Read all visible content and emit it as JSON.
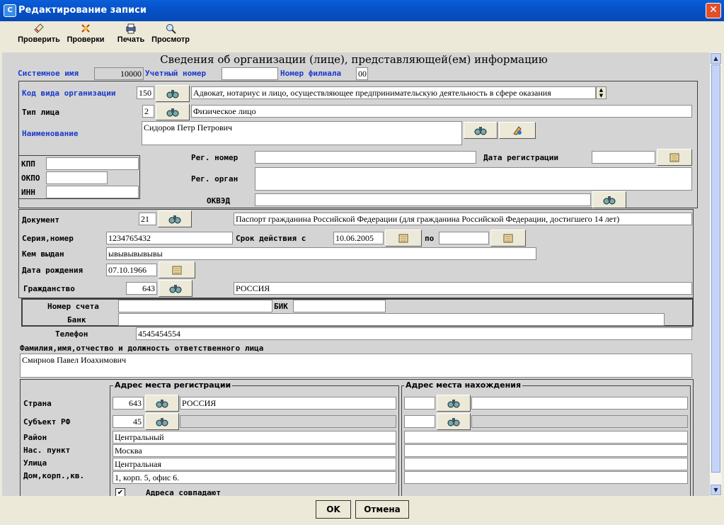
{
  "window": {
    "title": "Редактирование записи",
    "app_icon": "C"
  },
  "toolbar": {
    "check": "Проверить",
    "checks": "Проверки",
    "print": "Печать",
    "preview": "Просмотр"
  },
  "heading": "Сведения об организации (лице), представляющей(ем) информацию",
  "top": {
    "system_name_label": "Системное имя",
    "system_name_value": "10000",
    "account_number_label": "Учетный номер",
    "account_number_value": "",
    "branch_number_label": "Номер филиала",
    "branch_number_value": "00"
  },
  "org": {
    "kind_label": "Код вида организации",
    "kind_code": "150",
    "kind_text": "Адвокат, нотариус и лицо, осуществляющее предпринимательскую деятельность в сфере оказания",
    "person_type_label": "Тип лица",
    "person_type_code": "2",
    "person_type_text": "Физическое лицо",
    "name_label": "Наименование",
    "name_value": "Сидоров Петр Петрович",
    "kpp_label": "КПП",
    "kpp_value": "",
    "okpo_label": "ОКПО",
    "okpo_value": "",
    "inn_label": "ИНН",
    "inn_value": "",
    "reg_number_label": "Рег. номер",
    "reg_number_value": "",
    "reg_date_label": "Дата регистрации",
    "reg_date_value": "",
    "reg_organ_label": "Рег. орган",
    "reg_organ_value": "",
    "okved_label": "ОКВЭД",
    "okved_value": ""
  },
  "doc": {
    "document_label": "Документ",
    "document_code": "21",
    "document_text": "Паспорт гражданина Российской Федерации (для гражданина Российской Федерации, достигшего 14 лет)",
    "series_label": "Серия,номер",
    "series_value": "1234765432",
    "valid_from_label": "Срок действия с",
    "valid_from_value": "10.06.2005",
    "valid_to_label": "по",
    "valid_to_value": "",
    "issued_by_label": "Кем выдан",
    "issued_by_value": "ывывывывывы",
    "birth_date_label": "Дата рождения",
    "birth_date_value": "07.10.1966",
    "citizenship_label": "Гражданство",
    "citizenship_code": "643",
    "citizenship_text": "РОССИЯ"
  },
  "bank": {
    "account_label": "Номер счета",
    "account_value": "",
    "bik_label": "БИК",
    "bik_value": "",
    "bank_label": "Банк",
    "bank_value": ""
  },
  "phone": {
    "label": "Телефон",
    "value": "4545454554"
  },
  "responsible": {
    "label": "Фамилия,имя,отчество и должность ответственного лица",
    "value": "Смирнов Павел Иоахимович"
  },
  "address": {
    "reg_group": "Адрес места регистрации",
    "loc_group": "Адрес места нахождения",
    "country_label": "Страна",
    "subject_label": "Субъект РФ",
    "district_label": "Район",
    "locality_label": "Нас. пункт",
    "street_label": "Улица",
    "house_label": "Дом,корп.,кв.",
    "reg_country_code": "643",
    "reg_country_text": "РОССИЯ",
    "reg_subject_code": "45",
    "reg_subject_text": "",
    "reg_district": "Центральный",
    "reg_locality": "Москва",
    "reg_street": "Центральная",
    "reg_house": "1, корп. 5, офис 6.",
    "same_label": "Адреса совпадают",
    "same_checked": "✔"
  },
  "buttons": {
    "ok": "OK",
    "cancel": "Отмена"
  },
  "icons": {
    "lookup": "binoculars-icon",
    "calendar": "calendar-icon",
    "clear": "clear-icon",
    "check": "check-icon",
    "print": "printer-icon",
    "preview": "preview-icon"
  },
  "colors": {
    "title_bar": "#0653c9",
    "label_blue": "#1a3acc",
    "form_bg": "#d4d4d4"
  }
}
